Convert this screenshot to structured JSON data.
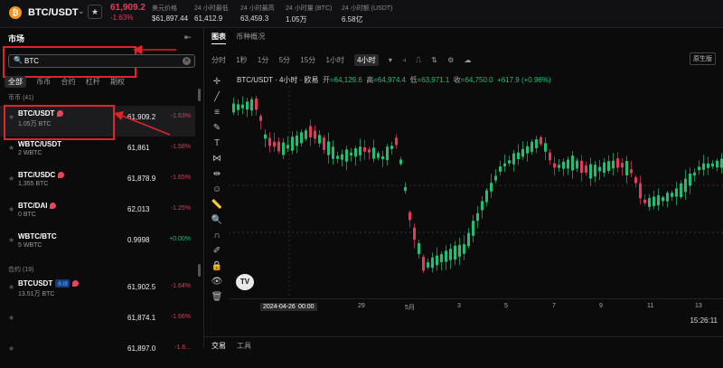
{
  "header": {
    "coin_icon": "₿",
    "pair": "BTC/USDT",
    "chevron": "⌄",
    "star_icon": "★",
    "price": "61,909.2",
    "change": "-1.63%",
    "stats": [
      {
        "label": "美元价格",
        "value": "$61,897.44"
      },
      {
        "label": "24 小时最低",
        "value": "61,412.9"
      },
      {
        "label": "24 小时最高",
        "value": "63,459.3"
      },
      {
        "label": "24 小时量 (BTC)",
        "value": "1.05万"
      },
      {
        "label": "24 小时额 (USDT)",
        "value": "6.58亿"
      }
    ]
  },
  "sidebar": {
    "title": "市场",
    "collapse_icon": "⇤",
    "search": {
      "icon": "🔍",
      "value": "BTC",
      "clear_icon": "✕"
    },
    "tabs": [
      "全部",
      "币币",
      "合约",
      "杠杆",
      "期权"
    ],
    "section_spot": "币币 (41)",
    "section_futures": "合约 (19)",
    "rows": [
      {
        "symbol": "BTC/USDT",
        "volume": "1.05万 BTC",
        "price": "61,909.2",
        "change": "-1.63%",
        "fire": true,
        "badge": ""
      },
      {
        "symbol": "WBTC/USDT",
        "volume": "2 WBTC",
        "price": "61,861",
        "change": "-1.58%",
        "fire": false,
        "badge": ""
      },
      {
        "symbol": "BTC/USDC",
        "volume": "1,355 BTC",
        "price": "61,878.9",
        "change": "-1.65%",
        "fire": true,
        "badge": ""
      },
      {
        "symbol": "BTC/DAI",
        "volume": "0 BTC",
        "price": "62,013",
        "change": "-1.25%",
        "fire": true,
        "badge": ""
      },
      {
        "symbol": "WBTC/BTC",
        "volume": "5 WBTC",
        "price": "0.9998",
        "change": "+0.00%",
        "fire": false,
        "badge": ""
      },
      {
        "symbol": "BTCUSDT",
        "volume": "13.51万 BTC",
        "price": "61,902.5",
        "change": "-1.64%",
        "fire": true,
        "badge": "永续"
      },
      {
        "symbol": "",
        "volume": "",
        "price": "61,874.1",
        "change": "-1.66%",
        "fire": false,
        "badge": ""
      },
      {
        "symbol": "",
        "volume": "",
        "price": "61,897.0",
        "change": "-1.6...",
        "fire": false,
        "badge": ""
      }
    ]
  },
  "chart": {
    "tabs": [
      "图表",
      "币种概况"
    ],
    "timeframes": [
      "分时",
      "1秒",
      "1分",
      "5分",
      "15分",
      "1小时",
      "4小时"
    ],
    "active_timeframe": "4小时",
    "toolbar_icons": [
      "⫞",
      "⎍",
      "⇅",
      "⚙",
      "☁"
    ],
    "original_label": "原生版",
    "title": "BTC/USDT · 4小时 · 欧易",
    "ohlc": {
      "o_label": "开",
      "o": "=64,129.6",
      "h_label": "高",
      "h": "=64,974.4",
      "l_label": "低",
      "l": "=63,971.1",
      "c_label": "收",
      "c": "=64,750.0",
      "delta": "+617.9 (+0.96%)"
    },
    "x_labels": [
      "2024-04-26",
      "00:00",
      "29",
      "5月",
      "3",
      "5",
      "7",
      "9",
      "11",
      "13"
    ],
    "time": "15:26:11",
    "tv_logo": "TV",
    "tool_icons": [
      "✛",
      "╱",
      "≡",
      "✎",
      "T",
      "⋈",
      "⇹",
      "☺",
      "📏",
      "🔍",
      "∩",
      "✐",
      "🔒",
      "👁",
      "🗑"
    ]
  },
  "bottom": {
    "tabs": [
      "交易",
      "工具"
    ]
  },
  "chart_data": {
    "type": "candlestick",
    "title": "BTC/USDT · 4小时 · 欧易",
    "x_tick_labels": [
      "2024-04-26",
      "29",
      "5月",
      "3",
      "5",
      "7",
      "9",
      "11",
      "13"
    ],
    "approx_range": [
      56500,
      67500
    ],
    "last": {
      "open": 64129.6,
      "high": 64974.4,
      "low": 63971.1,
      "close": 64750.0,
      "change": 617.9,
      "change_pct": 0.96
    }
  },
  "colors": {
    "up": "#1fbf75",
    "down": "#e23b5c",
    "accent_box": "#e0242b"
  }
}
